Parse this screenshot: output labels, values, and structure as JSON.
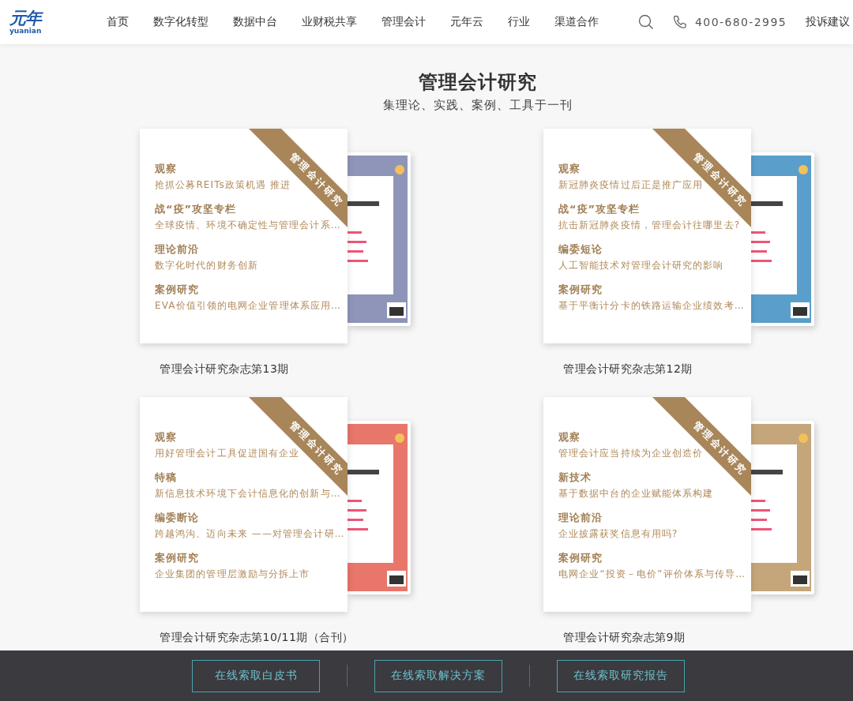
{
  "header": {
    "logo": {
      "mark": "元年",
      "subtext": "yuanian"
    },
    "nav": [
      {
        "label": "首页"
      },
      {
        "label": "数字化转型"
      },
      {
        "label": "数据中台"
      },
      {
        "label": "业财税共享"
      },
      {
        "label": "管理会计"
      },
      {
        "label": "元年云"
      },
      {
        "label": "行业"
      },
      {
        "label": "渠道合作"
      }
    ],
    "phone": "400-680-2995",
    "feedback_link": "投诉建议"
  },
  "section": {
    "title": "管理会计研究",
    "subtitle": "集理论、实践、案例、工具于一刊"
  },
  "issues": [
    {
      "ribbon": "管理会计研究",
      "caption": "管理会计研究杂志第13期",
      "articles": [
        {
          "column": "观察",
          "headline": "抢抓公募REITs政策机遇 推进"
        },
        {
          "column": "战“疫”攻坚专栏",
          "headline": "全球疫情、环境不确定性与管理会计系…"
        },
        {
          "column": "理论前沿",
          "headline": "数字化时代的财务创新"
        },
        {
          "column": "案例研究",
          "headline": "EVA价值引领的电网企业管理体系应用…"
        }
      ]
    },
    {
      "ribbon": "管理会计研究",
      "caption": "管理会计研究杂志第12期",
      "articles": [
        {
          "column": "观察",
          "headline": "新冠肺炎疫情过后正是推广应用"
        },
        {
          "column": "战“疫”攻坚专栏",
          "headline": "抗击新冠肺炎疫情，管理会计往哪里去?"
        },
        {
          "column": "编委短论",
          "headline": "人工智能技术对管理会计研究的影响"
        },
        {
          "column": "案例研究",
          "headline": "基于平衡计分卡的铁路运输企业绩效考…"
        }
      ]
    },
    {
      "ribbon": "管理会计研究",
      "caption": "管理会计研究杂志第10/11期（合刊）",
      "articles": [
        {
          "column": "观察",
          "headline": "用好管理会计工具促进国有企业"
        },
        {
          "column": "特稿",
          "headline": "新信息技术环境下会计信息化的创新与…"
        },
        {
          "column": "编委断论",
          "headline": "跨越鸿沟、迈向未来 ——对管理会计研…"
        },
        {
          "column": "案例研究",
          "headline": "企业集团的管理层激励与分拆上市"
        }
      ]
    },
    {
      "ribbon": "管理会计研究",
      "caption": "管理会计研究杂志第9期",
      "articles": [
        {
          "column": "观察",
          "headline": "管理会计应当持续为企业创造价"
        },
        {
          "column": "新技术",
          "headline": "基于数据中台的企业赋能体系构建"
        },
        {
          "column": "理论前沿",
          "headline": "企业披露获奖信息有用吗?"
        },
        {
          "column": "案例研究",
          "headline": "电网企业“投资－电价”评价体系与传导…"
        }
      ]
    }
  ],
  "footer": {
    "buttons": [
      {
        "label": "在线索取白皮书"
      },
      {
        "label": "在线索取解决方案"
      },
      {
        "label": "在线索取研究报告"
      }
    ]
  }
}
